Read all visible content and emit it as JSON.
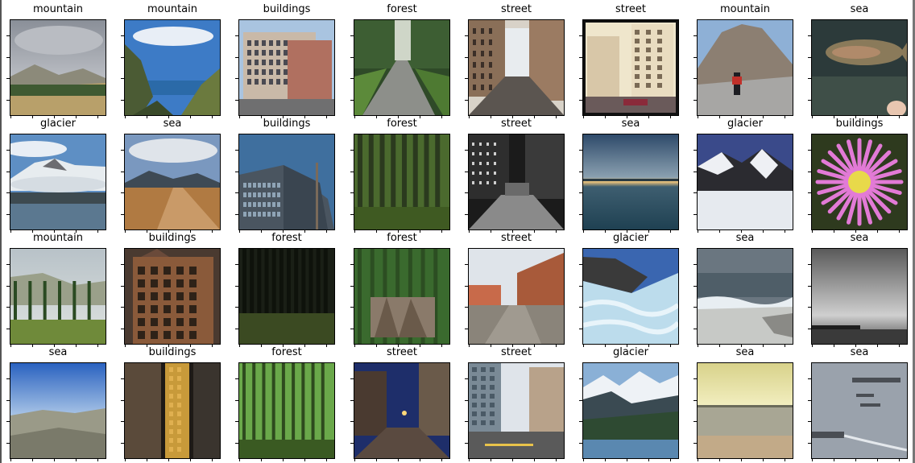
{
  "panels": [
    {
      "label": "mountain",
      "scene": "mountain"
    },
    {
      "label": "mountain",
      "scene": "coast"
    },
    {
      "label": "buildings",
      "scene": "buildings"
    },
    {
      "label": "forest",
      "scene": "forest-road"
    },
    {
      "label": "street",
      "scene": "street"
    },
    {
      "label": "street",
      "scene": "street-bright"
    },
    {
      "label": "mountain",
      "scene": "rocky-mountain"
    },
    {
      "label": "sea",
      "scene": "fish"
    },
    {
      "label": "glacier",
      "scene": "snow-mountain-lake"
    },
    {
      "label": "sea",
      "scene": "dirt-road"
    },
    {
      "label": "buildings",
      "scene": "modern-building"
    },
    {
      "label": "forest",
      "scene": "forest"
    },
    {
      "label": "street",
      "scene": "street-night-bw"
    },
    {
      "label": "sea",
      "scene": "sea-sunset"
    },
    {
      "label": "glacier",
      "scene": "glacier-peak"
    },
    {
      "label": "buildings",
      "scene": "flower"
    },
    {
      "label": "mountain",
      "scene": "meadow"
    },
    {
      "label": "buildings",
      "scene": "old-building"
    },
    {
      "label": "forest",
      "scene": "dark-forest"
    },
    {
      "label": "forest",
      "scene": "forest-sculpture"
    },
    {
      "label": "street",
      "scene": "street-construction"
    },
    {
      "label": "glacier",
      "scene": "glacier-ice"
    },
    {
      "label": "sea",
      "scene": "waves"
    },
    {
      "label": "sea",
      "scene": "sea-bw"
    },
    {
      "label": "sea",
      "scene": "aerial-hills"
    },
    {
      "label": "buildings",
      "scene": "facade"
    },
    {
      "label": "forest",
      "scene": "green-forest"
    },
    {
      "label": "street",
      "scene": "street-dusk"
    },
    {
      "label": "street",
      "scene": "city-street"
    },
    {
      "label": "glacier",
      "scene": "snow-range-lake"
    },
    {
      "label": "sea",
      "scene": "beach-sunset"
    },
    {
      "label": "sea",
      "scene": "ships"
    }
  ]
}
